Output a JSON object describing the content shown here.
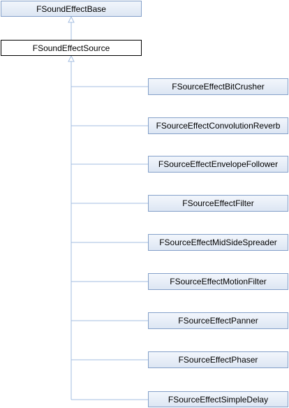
{
  "diagram": {
    "base_class": "FSoundEffectBase",
    "current_class": "FSoundEffectSource",
    "derived_classes": [
      "FSourceEffectBitCrusher",
      "FSourceEffectConvolutionReverb",
      "FSourceEffectEnvelopeFollower",
      "FSourceEffectFilter",
      "FSourceEffectMidSideSpreader",
      "FSourceEffectMotionFilter",
      "FSourceEffectPanner",
      "FSourceEffectPhaser",
      "FSourceEffectSimpleDelay"
    ],
    "colors": {
      "edge": "#a3bde0",
      "linked_border": "#84a0c9",
      "current_border": "#000000"
    }
  }
}
